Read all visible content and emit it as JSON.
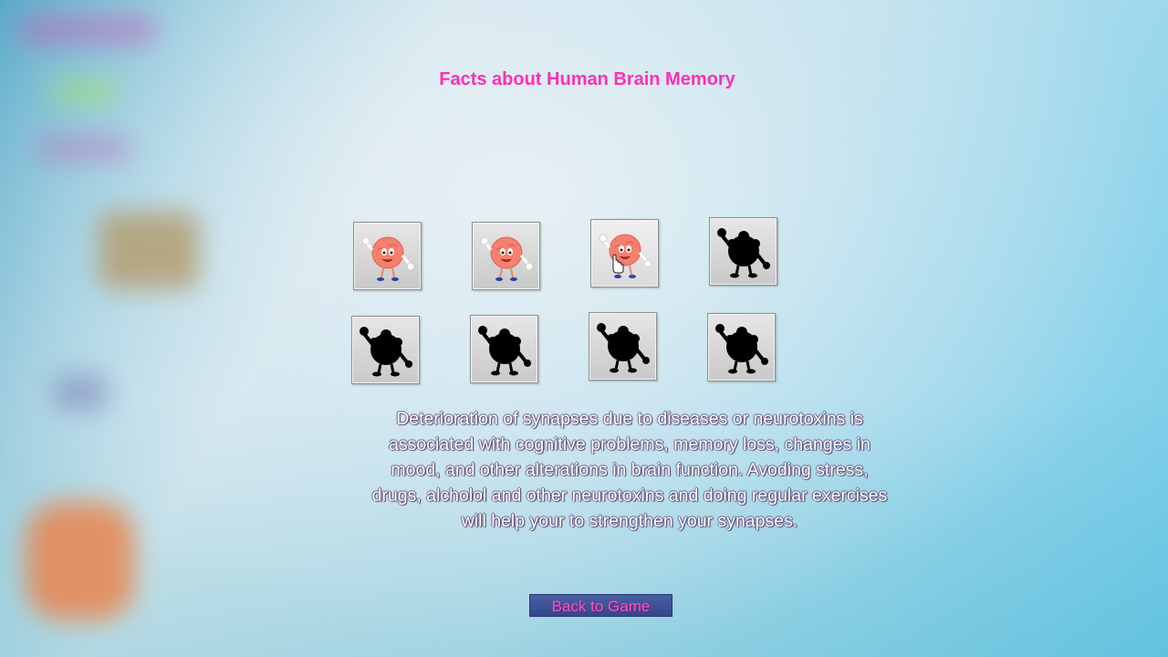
{
  "title": "Facts about Human Brain Memory",
  "colors": {
    "title": "#ff2fb4",
    "button_text": "#ff4fc8",
    "button_bg": "#3d50930",
    "revealed_brain": "#f4806d",
    "hidden_brain": "#000000"
  },
  "tiles": [
    {
      "state": "revealed",
      "icon": "brain-character-icon"
    },
    {
      "state": "revealed",
      "icon": "brain-character-icon"
    },
    {
      "state": "revealed",
      "icon": "brain-character-icon"
    },
    {
      "state": "hidden",
      "icon": "brain-silhouette-icon"
    },
    {
      "state": "hidden",
      "icon": "brain-silhouette-icon"
    },
    {
      "state": "hidden",
      "icon": "brain-silhouette-icon"
    },
    {
      "state": "hidden",
      "icon": "brain-silhouette-icon"
    },
    {
      "state": "hidden",
      "icon": "brain-silhouette-icon"
    }
  ],
  "fact_lines": [
    "Deterioration of synapses due to diseases or neurotoxins is",
    "associated with cognitive problems, memory loss, changes in",
    "mood, and other alterations in brain function. Avoding stress,",
    "drugs, alcholol and other neurotoxins and doing regular exercises",
    "will help your to strengthen your synapses."
  ],
  "back_button_label": "Back to Game"
}
